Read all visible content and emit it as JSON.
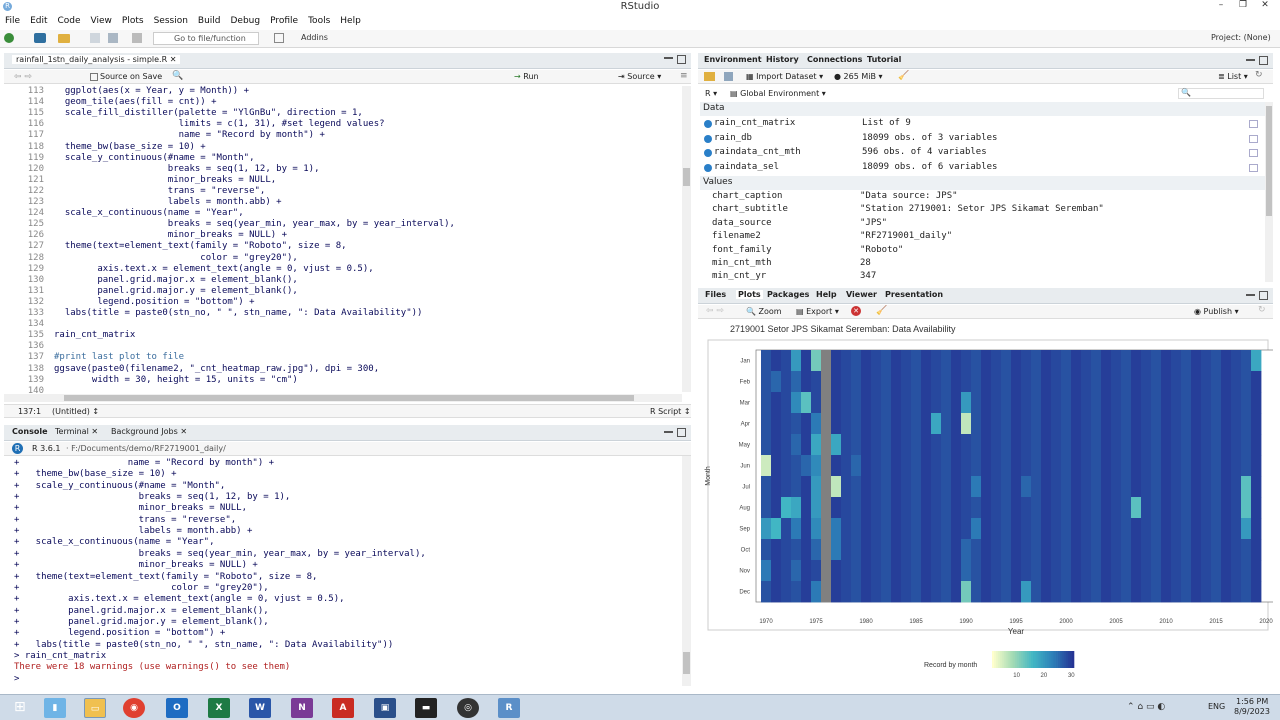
{
  "window": {
    "title": "RStudio"
  },
  "menu": [
    "File",
    "Edit",
    "Code",
    "View",
    "Plots",
    "Session",
    "Build",
    "Debug",
    "Profile",
    "Tools",
    "Help"
  ],
  "toolbar": {
    "goto_placeholder": "Go to file/function",
    "addins": "Addins",
    "project": "Project: (None)"
  },
  "editor": {
    "tab": "rainfall_1stn_daily_analysis - simple.R",
    "source_on_save": "Source on Save",
    "run": "Run",
    "source": "Source",
    "lines": [
      {
        "n": "113",
        "t": "  ggplot(aes(x = Year, y = Month)) +"
      },
      {
        "n": "114",
        "t": "  geom_tile(aes(fill = cnt)) +"
      },
      {
        "n": "115",
        "t": "  scale_fill_distiller(palette = \"YlGnBu\", direction = 1,"
      },
      {
        "n": "116",
        "t": "                       limits = c(1, 31), #set legend values?"
      },
      {
        "n": "117",
        "t": "                       name = \"Record by month\") +"
      },
      {
        "n": "118",
        "t": "  theme_bw(base_size = 10) +"
      },
      {
        "n": "119",
        "t": "  scale_y_continuous(#name = \"Month\","
      },
      {
        "n": "120",
        "t": "                     breaks = seq(1, 12, by = 1),"
      },
      {
        "n": "121",
        "t": "                     minor_breaks = NULL,"
      },
      {
        "n": "122",
        "t": "                     trans = \"reverse\","
      },
      {
        "n": "123",
        "t": "                     labels = month.abb) +"
      },
      {
        "n": "124",
        "t": "  scale_x_continuous(name = \"Year\","
      },
      {
        "n": "125",
        "t": "                     breaks = seq(year_min, year_max, by = year_interval),"
      },
      {
        "n": "126",
        "t": "                     minor_breaks = NULL) +"
      },
      {
        "n": "127",
        "t": "  theme(text=element_text(family = \"Roboto\", size = 8,"
      },
      {
        "n": "128",
        "t": "                           color = \"grey20\"),"
      },
      {
        "n": "129",
        "t": "        axis.text.x = element_text(angle = 0, vjust = 0.5),"
      },
      {
        "n": "130",
        "t": "        panel.grid.major.x = element_blank(),"
      },
      {
        "n": "131",
        "t": "        panel.grid.major.y = element_blank(),"
      },
      {
        "n": "132",
        "t": "        legend.position = \"bottom\") +"
      },
      {
        "n": "133",
        "t": "  labs(title = paste0(stn_no, \" \", stn_name, \": Data Availability\"))"
      },
      {
        "n": "134",
        "t": ""
      },
      {
        "n": "135",
        "t": "rain_cnt_matrix"
      },
      {
        "n": "136",
        "t": ""
      },
      {
        "n": "137",
        "t": "#print last plot to file"
      },
      {
        "n": "138",
        "t": "ggsave(paste0(filename2, \"_cnt_heatmap_raw.jpg\"), dpi = 300,"
      },
      {
        "n": "139",
        "t": "       width = 30, height = 15, units = \"cm\")"
      },
      {
        "n": "140",
        "t": ""
      },
      {
        "n": "141",
        "t": ""
      }
    ],
    "status_pos": "137:1",
    "status_scope": "(Untitled)",
    "status_lang": "R Script"
  },
  "console": {
    "tabs": [
      "Console",
      "Terminal",
      "Background Jobs"
    ],
    "rversion": "R 3.6.1",
    "path": "F:/Documents/demo/RF2719001_daily/",
    "lines": [
      "+                    name = \"Record by month\") +",
      "+   theme_bw(base_size = 10) +",
      "+   scale_y_continuous(#name = \"Month\",",
      "+                      breaks = seq(1, 12, by = 1),",
      "+                      minor_breaks = NULL,",
      "+                      trans = \"reverse\",",
      "+                      labels = month.abb) +",
      "+   scale_x_continuous(name = \"Year\",",
      "+                      breaks = seq(year_min, year_max, by = year_interval),",
      "+                      minor_breaks = NULL) +",
      "+   theme(text=element_text(family = \"Roboto\", size = 8,",
      "+                            color = \"grey20\"),",
      "+         axis.text.x = element_text(angle = 0, vjust = 0.5),",
      "+         panel.grid.major.x = element_blank(),",
      "+         panel.grid.major.y = element_blank(),",
      "+         legend.position = \"bottom\") +",
      "+   labs(title = paste0(stn_no, \" \", stn_name, \": Data Availability\"))",
      "> rain_cnt_matrix"
    ],
    "warning": "There were 18 warnings (use warnings() to see them)",
    "prompt": ">"
  },
  "env": {
    "tabs": [
      "Environment",
      "History",
      "Connections",
      "Tutorial"
    ],
    "import": "Import Dataset",
    "mem": "265 MiB",
    "list": "List",
    "lang": "R",
    "scope": "Global Environment",
    "data_hdr": "Data",
    "values_hdr": "Values",
    "data": [
      {
        "name": "rain_cnt_matrix",
        "value": "List of  9"
      },
      {
        "name": "rain_db",
        "value": "18099 obs. of 3 variables"
      },
      {
        "name": "raindata_cnt_mth",
        "value": "596 obs. of 4 variables"
      },
      {
        "name": "raindata_sel",
        "value": "18099 obs. of 6 variables"
      }
    ],
    "values": [
      {
        "name": "chart_caption",
        "value": "\"Data source: JPS\""
      },
      {
        "name": "chart_subtitle",
        "value": "\"Station 2719001: Setor JPS Sikamat Seremban\""
      },
      {
        "name": "data_source",
        "value": "\"JPS\""
      },
      {
        "name": "filename2",
        "value": "\"RF2719001_daily\""
      },
      {
        "name": "font_family",
        "value": "\"Roboto\""
      },
      {
        "name": "min_cnt_mth",
        "value": "28"
      },
      {
        "name": "min_cnt_yr",
        "value": "347"
      }
    ]
  },
  "plots": {
    "tabs": [
      "Files",
      "Plots",
      "Packages",
      "Help",
      "Viewer",
      "Presentation"
    ],
    "zoom": "Zoom",
    "export": "Export",
    "publish": "Publish"
  },
  "chart_data": {
    "type": "heatmap",
    "title": "2719001 Setor JPS Sikamat Seremban: Data Availability",
    "xlabel": "Year",
    "ylabel": "Month",
    "x_ticks": [
      1970,
      1975,
      1980,
      1985,
      1990,
      1995,
      2000,
      2005,
      2010,
      2015,
      2020
    ],
    "y_ticks": [
      "Jan",
      "Feb",
      "Mar",
      "Apr",
      "May",
      "Jun",
      "Jul",
      "Aug",
      "Sep",
      "Oct",
      "Nov",
      "Dec"
    ],
    "xlim": [
      1969,
      2021
    ],
    "legend_title": "Record by month",
    "legend_ticks": [
      10,
      20,
      30
    ],
    "legend_position": "bottom",
    "palette": [
      "#ffffcc",
      "#a1dab4",
      "#41b6c4",
      "#2c7fb8",
      "#253494"
    ],
    "missing_color": "#808080",
    "year_start": 1970,
    "year_end": 2019,
    "default_value": 30,
    "missing_year": 1976,
    "anomalies": [
      {
        "year": 1973,
        "month": 1,
        "value": 20
      },
      {
        "year": 1975,
        "month": 1,
        "value": 12
      },
      {
        "year": 1971,
        "month": 2,
        "value": 26
      },
      {
        "year": 1973,
        "month": 2,
        "value": 26
      },
      {
        "year": 1973,
        "month": 3,
        "value": 22
      },
      {
        "year": 1974,
        "month": 3,
        "value": 14
      },
      {
        "year": 1990,
        "month": 3,
        "value": 20
      },
      {
        "year": 1975,
        "month": 4,
        "value": 24
      },
      {
        "year": 1987,
        "month": 4,
        "value": 18
      },
      {
        "year": 1990,
        "month": 4,
        "value": 6
      },
      {
        "year": 1973,
        "month": 5,
        "value": 26
      },
      {
        "year": 1975,
        "month": 5,
        "value": 18
      },
      {
        "year": 1977,
        "month": 5,
        "value": 18
      },
      {
        "year": 1970,
        "month": 6,
        "value": 5
      },
      {
        "year": 1975,
        "month": 6,
        "value": 22
      },
      {
        "year": 1974,
        "month": 6,
        "value": 26
      },
      {
        "year": 1979,
        "month": 6,
        "value": 26
      },
      {
        "year": 1977,
        "month": 7,
        "value": 6
      },
      {
        "year": 1975,
        "month": 7,
        "value": 20
      },
      {
        "year": 1991,
        "month": 7,
        "value": 24
      },
      {
        "year": 1996,
        "month": 7,
        "value": 26
      },
      {
        "year": 2018,
        "month": 7,
        "value": 14
      },
      {
        "year": 1972,
        "month": 8,
        "value": 16
      },
      {
        "year": 1973,
        "month": 8,
        "value": 18
      },
      {
        "year": 1975,
        "month": 8,
        "value": 20
      },
      {
        "year": 2007,
        "month": 8,
        "value": 14
      },
      {
        "year": 2018,
        "month": 8,
        "value": 14
      },
      {
        "year": 1970,
        "month": 9,
        "value": 20
      },
      {
        "year": 1971,
        "month": 9,
        "value": 16
      },
      {
        "year": 1973,
        "month": 9,
        "value": 24
      },
      {
        "year": 1975,
        "month": 9,
        "value": 22
      },
      {
        "year": 1977,
        "month": 9,
        "value": 24
      },
      {
        "year": 1991,
        "month": 9,
        "value": 24
      },
      {
        "year": 2018,
        "month": 9,
        "value": 20
      },
      {
        "year": 1977,
        "month": 10,
        "value": 24
      },
      {
        "year": 1975,
        "month": 10,
        "value": 26
      },
      {
        "year": 1990,
        "month": 10,
        "value": 26
      },
      {
        "year": 1970,
        "month": 11,
        "value": 24
      },
      {
        "year": 1973,
        "month": 11,
        "value": 26
      },
      {
        "year": 1990,
        "month": 11,
        "value": 26
      },
      {
        "year": 1975,
        "month": 12,
        "value": 24
      },
      {
        "year": 1990,
        "month": 12,
        "value": 12
      },
      {
        "year": 1996,
        "month": 12,
        "value": 20
      },
      {
        "year": 2019,
        "month": 1,
        "value": 18
      }
    ]
  },
  "taskbar": {
    "lang": "ENG",
    "time": "1:56 PM",
    "date": "8/9/2023",
    "apps": [
      "O",
      "X",
      "W",
      "N",
      "R"
    ]
  }
}
